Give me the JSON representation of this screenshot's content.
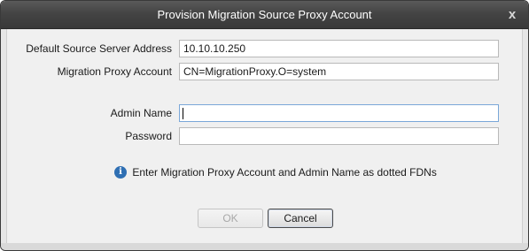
{
  "window": {
    "title": "Provision Migration Source Proxy Account",
    "close_glyph": "x"
  },
  "form": {
    "source_server": {
      "label": "Default Source Server Address",
      "value": "10.10.10.250"
    },
    "proxy_account": {
      "label": "Migration Proxy Account",
      "value": "CN=MigrationProxy.O=system"
    },
    "admin_name": {
      "label": "Admin Name",
      "value": ""
    },
    "password": {
      "label": "Password",
      "value": ""
    }
  },
  "info": {
    "icon": "info-icon",
    "icon_glyph": "i",
    "text": "Enter Migration Proxy Account and Admin Name as dotted FDNs"
  },
  "buttons": {
    "ok_label": "OK",
    "cancel_label": "Cancel"
  },
  "colors": {
    "titlebar": "#444444",
    "info_icon": "#2f6fb3",
    "focus_border": "#7aa7d8"
  }
}
